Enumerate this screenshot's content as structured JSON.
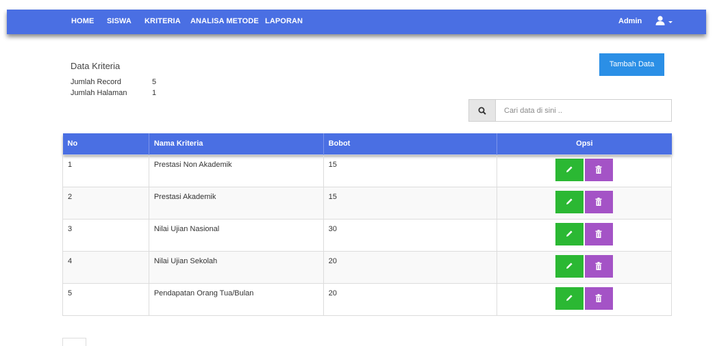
{
  "nav": {
    "items": [
      "HOME",
      "SISWA",
      "KRITERIA",
      "ANALISA METODE",
      "LAPORAN"
    ],
    "admin_label": "Admin",
    "user_icon": "user-icon",
    "bg_color": "#4a6fe3"
  },
  "page": {
    "title": "Data Kriteria",
    "record_label": "Jumlah Record",
    "record_value": "5",
    "pages_label": "Jumlah Halaman",
    "pages_value": "1",
    "add_button": "Tambah Data"
  },
  "search": {
    "placeholder": "Cari data di sini ..",
    "icon": "search-icon"
  },
  "table": {
    "headers": [
      "No",
      "Nama Kriteria",
      "Bobot",
      "Opsi"
    ],
    "rows": [
      {
        "no": "1",
        "nama": "Prestasi Non Akademik",
        "bobot": "15"
      },
      {
        "no": "2",
        "nama": "Prestasi Akademik",
        "bobot": "15"
      },
      {
        "no": "3",
        "nama": "Nilai Ujian Nasional",
        "bobot": "30"
      },
      {
        "no": "4",
        "nama": "Nilai Ujian Sekolah",
        "bobot": "20"
      },
      {
        "no": "5",
        "nama": "Pendapatan Orang Tua/Bulan",
        "bobot": "20"
      }
    ],
    "edit_color": "#2bb833",
    "delete_color": "#a453c6"
  }
}
